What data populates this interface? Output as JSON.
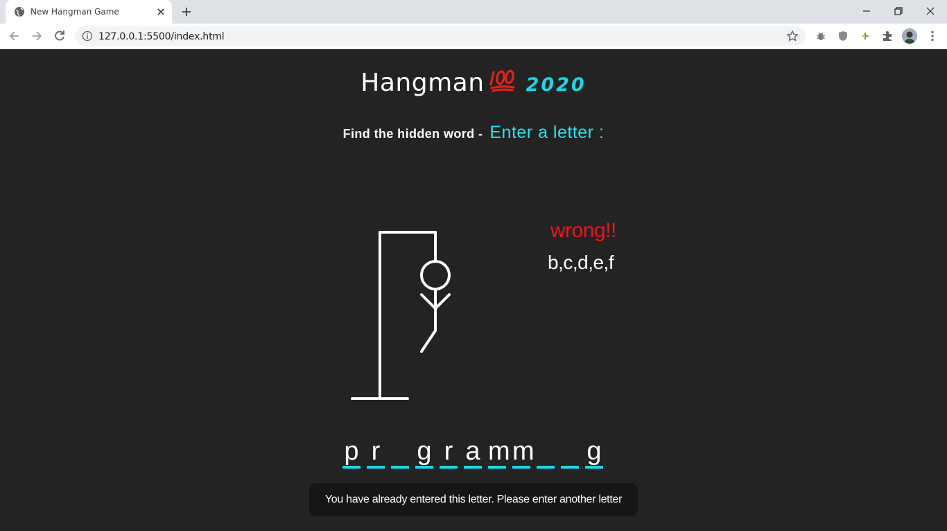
{
  "browser": {
    "tab_title": "New Hangman Game",
    "url": "127.0.0.1:5500/index.html"
  },
  "game": {
    "title": "Hangman",
    "title_emoji": "hundred-points-icon",
    "year": "2020",
    "prompt": "Find the hidden word -",
    "prompt_cta": "Enter a letter :",
    "wrong_title": "wrong!!",
    "wrong_letters": "b,c,d,e,f",
    "word_slots": [
      "p",
      "r",
      "",
      "g",
      "r",
      "a",
      "m",
      "m",
      "",
      "",
      "g"
    ],
    "toast": "You have already entered this letter. Please enter another letter"
  },
  "colors": {
    "background": "#232323",
    "accent_cyan": "#1ad8e6",
    "wrong_red": "#f0141e"
  }
}
